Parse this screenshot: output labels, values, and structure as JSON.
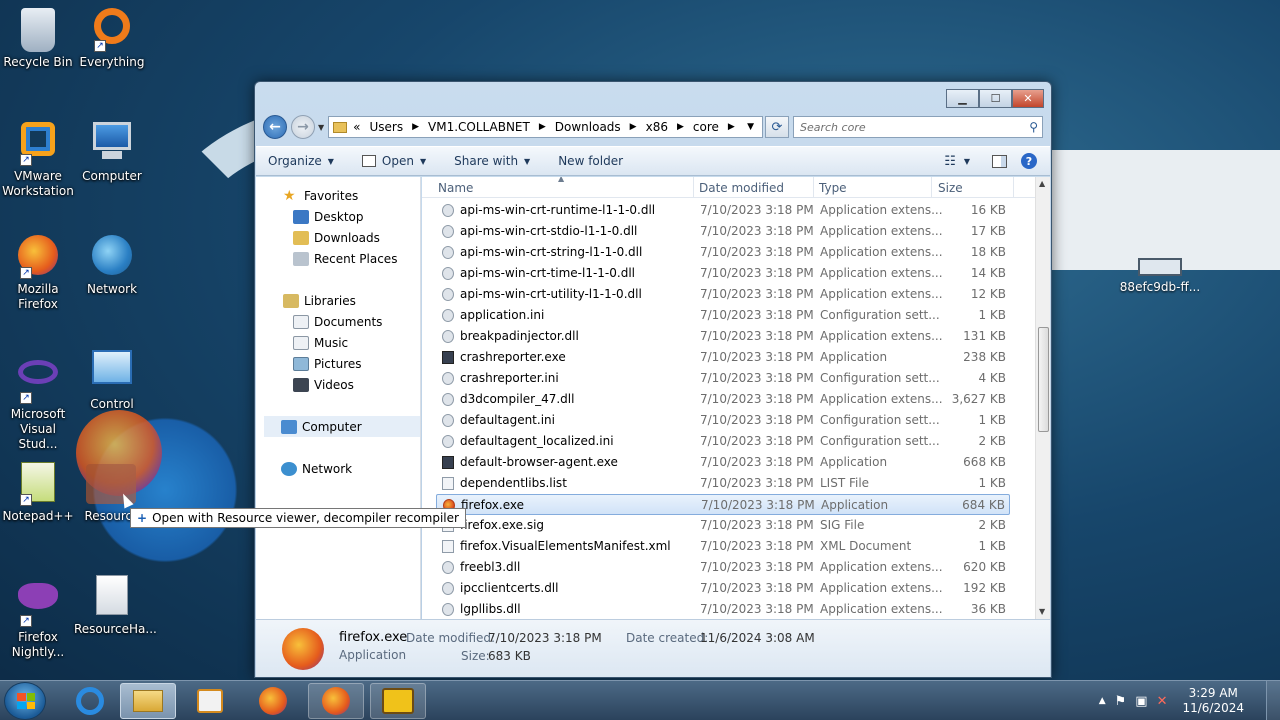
{
  "desktop": {
    "icons": [
      {
        "label": "Recycle Bin",
        "icon": "recycle-bin-icon"
      },
      {
        "label": "Everything",
        "icon": "everything-search-icon"
      },
      {
        "label": "VMware Workstation",
        "icon": "vmware-icon"
      },
      {
        "label": "Computer",
        "icon": "computer-icon"
      },
      {
        "label": "Mozilla Firefox",
        "icon": "firefox-icon"
      },
      {
        "label": "Network",
        "icon": "network-icon"
      },
      {
        "label": "Microsoft Visual Stud...",
        "icon": "visual-studio-icon"
      },
      {
        "label": "Control",
        "icon": "control-panel-icon"
      },
      {
        "label": "Notepad++",
        "icon": "notepadpp-icon"
      },
      {
        "label": "Resource",
        "icon": "resource-hacker-icon"
      },
      {
        "label": "Firefox Nightly...",
        "icon": "firefox-nightly-icon"
      },
      {
        "label": "ResourceHa...",
        "icon": "resource-hacker-setup-icon"
      }
    ],
    "right_item": "88efc9db-ff..."
  },
  "drag_tooltip": "Open with Resource viewer, decompiler recompiler",
  "explorer": {
    "address": {
      "prefix": "«",
      "crumbs": [
        "Users",
        "VM1.COLLABNET",
        "Downloads",
        "x86",
        "core"
      ]
    },
    "search_placeholder": "Search core",
    "commands": [
      "Organize",
      "Open",
      "Share with",
      "New folder"
    ],
    "nav": {
      "favorites": "Favorites",
      "favorites_items": [
        "Desktop",
        "Downloads",
        "Recent Places"
      ],
      "libraries": "Libraries",
      "libraries_items": [
        "Documents",
        "Music",
        "Pictures",
        "Videos"
      ],
      "computer": "Computer",
      "network": "Network"
    },
    "columns": [
      "Name",
      "Date modified",
      "Type",
      "Size"
    ],
    "files": [
      {
        "name": "api-ms-win-crt-runtime-l1-1-0.dll",
        "date": "7/10/2023 3:18 PM",
        "type": "Application extens...",
        "size": "16 KB",
        "kind": "dll"
      },
      {
        "name": "api-ms-win-crt-stdio-l1-1-0.dll",
        "date": "7/10/2023 3:18 PM",
        "type": "Application extens...",
        "size": "17 KB",
        "kind": "dll"
      },
      {
        "name": "api-ms-win-crt-string-l1-1-0.dll",
        "date": "7/10/2023 3:18 PM",
        "type": "Application extens...",
        "size": "18 KB",
        "kind": "dll"
      },
      {
        "name": "api-ms-win-crt-time-l1-1-0.dll",
        "date": "7/10/2023 3:18 PM",
        "type": "Application extens...",
        "size": "14 KB",
        "kind": "dll"
      },
      {
        "name": "api-ms-win-crt-utility-l1-1-0.dll",
        "date": "7/10/2023 3:18 PM",
        "type": "Application extens...",
        "size": "12 KB",
        "kind": "dll"
      },
      {
        "name": "application.ini",
        "date": "7/10/2023 3:18 PM",
        "type": "Configuration sett...",
        "size": "1 KB",
        "kind": "ini"
      },
      {
        "name": "breakpadinjector.dll",
        "date": "7/10/2023 3:18 PM",
        "type": "Application extens...",
        "size": "131 KB",
        "kind": "dll"
      },
      {
        "name": "crashreporter.exe",
        "date": "7/10/2023 3:18 PM",
        "type": "Application",
        "size": "238 KB",
        "kind": "app"
      },
      {
        "name": "crashreporter.ini",
        "date": "7/10/2023 3:18 PM",
        "type": "Configuration sett...",
        "size": "4 KB",
        "kind": "ini"
      },
      {
        "name": "d3dcompiler_47.dll",
        "date": "7/10/2023 3:18 PM",
        "type": "Application extens...",
        "size": "3,627 KB",
        "kind": "dll"
      },
      {
        "name": "defaultagent.ini",
        "date": "7/10/2023 3:18 PM",
        "type": "Configuration sett...",
        "size": "1 KB",
        "kind": "ini"
      },
      {
        "name": "defaultagent_localized.ini",
        "date": "7/10/2023 3:18 PM",
        "type": "Configuration sett...",
        "size": "2 KB",
        "kind": "ini"
      },
      {
        "name": "default-browser-agent.exe",
        "date": "7/10/2023 3:18 PM",
        "type": "Application",
        "size": "668 KB",
        "kind": "app"
      },
      {
        "name": "dependentlibs.list",
        "date": "7/10/2023 3:18 PM",
        "type": "LIST File",
        "size": "1 KB",
        "kind": "file"
      },
      {
        "name": "firefox.exe",
        "date": "7/10/2023 3:18 PM",
        "type": "Application",
        "size": "684 KB",
        "kind": "ff",
        "selected": true
      },
      {
        "name": "firefox.exe.sig",
        "date": "7/10/2023 3:18 PM",
        "type": "SIG File",
        "size": "2 KB",
        "kind": "file"
      },
      {
        "name": "firefox.VisualElementsManifest.xml",
        "date": "7/10/2023 3:18 PM",
        "type": "XML Document",
        "size": "1 KB",
        "kind": "file"
      },
      {
        "name": "freebl3.dll",
        "date": "7/10/2023 3:18 PM",
        "type": "Application extens...",
        "size": "620 KB",
        "kind": "dll"
      },
      {
        "name": "ipcclientcerts.dll",
        "date": "7/10/2023 3:18 PM",
        "type": "Application extens...",
        "size": "192 KB",
        "kind": "dll"
      },
      {
        "name": "lgpllibs.dll",
        "date": "7/10/2023 3:18 PM",
        "type": "Application extens...",
        "size": "36 KB",
        "kind": "dll"
      }
    ],
    "details": {
      "name": "firefox.exe",
      "kind": "Application",
      "modified_label": "Date modified:",
      "modified": "7/10/2023 3:18 PM",
      "created_label": "Date created:",
      "created": "11/6/2024 3:08 AM",
      "size_label": "Size:",
      "size": "683 KB"
    }
  },
  "taskbar": {
    "time": "3:29 AM",
    "date": "11/6/2024"
  }
}
